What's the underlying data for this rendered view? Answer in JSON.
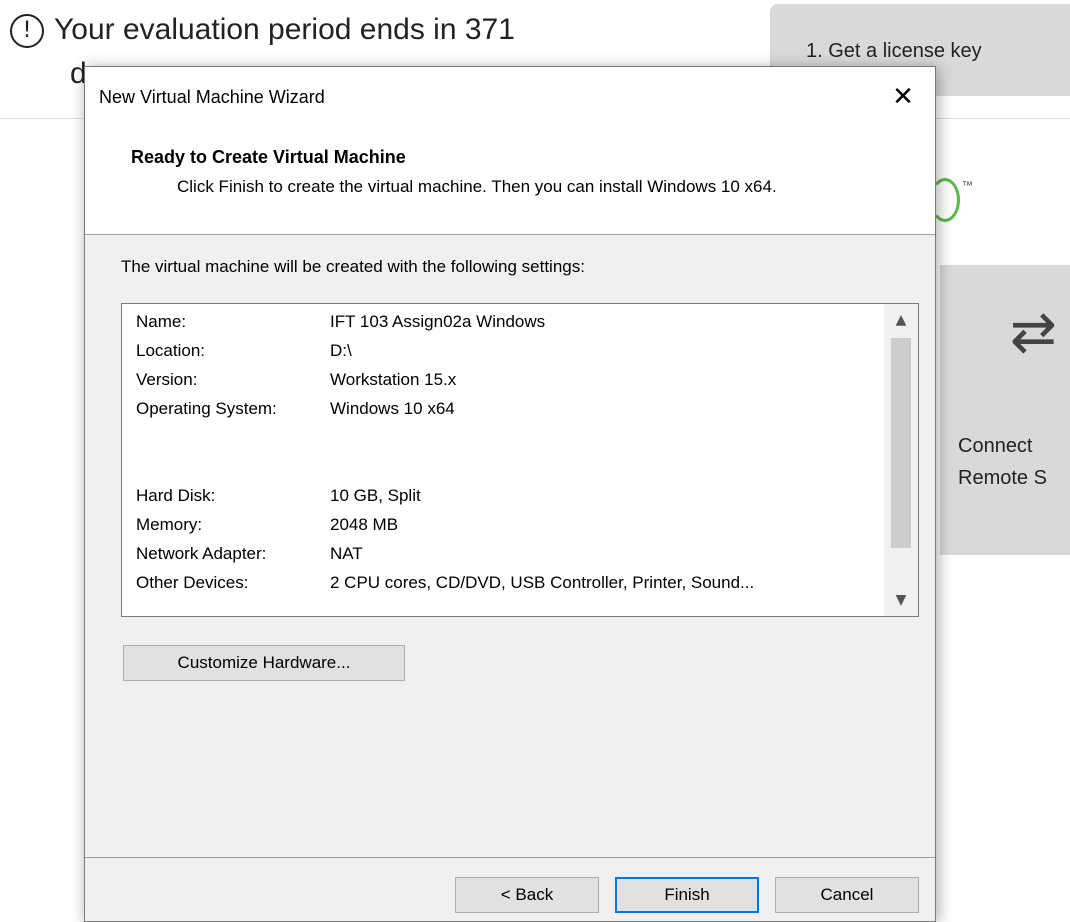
{
  "background": {
    "eval_icon_glyph": "!",
    "eval_text_line1": "Your evaluation period ends in 371",
    "eval_text_line2": "d",
    "license_button": "1. Get a license key",
    "tm_mark": "™",
    "connect_arrows": "⇄",
    "connect_label_line1": "Connect",
    "connect_label_line2": "Remote S"
  },
  "dialog": {
    "title": "New Virtual Machine Wizard",
    "close_glyph": "✕",
    "header": {
      "title": "Ready to Create Virtual Machine",
      "description": "Click Finish to create the virtual machine. Then you can install Windows 10 x64."
    },
    "intro": "The virtual machine will be created with the following settings:",
    "settings": [
      {
        "key": "Name:",
        "value": "IFT 103 Assign02a Windows"
      },
      {
        "key": "Location:",
        "value": "D:\\"
      },
      {
        "key": "Version:",
        "value": "Workstation 15.x"
      },
      {
        "key": "Operating System:",
        "value": "Windows 10 x64"
      },
      {
        "key": "Hard Disk:",
        "value": "10 GB, Split"
      },
      {
        "key": "Memory:",
        "value": "2048 MB"
      },
      {
        "key": "Network Adapter:",
        "value": "NAT"
      },
      {
        "key": "Other Devices:",
        "value": "2 CPU cores, CD/DVD, USB Controller, Printer, Sound..."
      }
    ],
    "scroll_up_glyph": "▲",
    "scroll_down_glyph": "▼",
    "buttons": {
      "customize": "Customize Hardware...",
      "back": "< Back",
      "finish": "Finish",
      "cancel": "Cancel"
    }
  },
  "colors": {
    "accent": "#0078d7",
    "logo_green": "#5bb84a",
    "tile_gray": "#d9d9d9",
    "dialog_bg": "#f0f0f0"
  }
}
